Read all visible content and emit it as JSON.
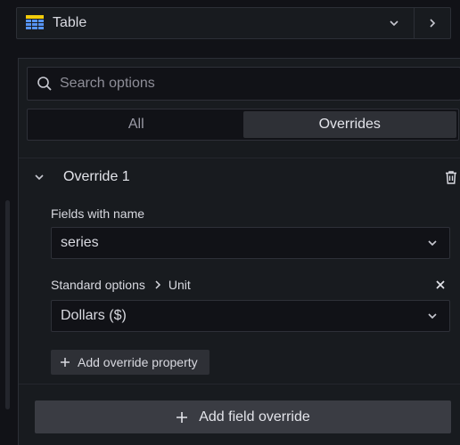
{
  "visualization": {
    "name": "Table",
    "icon": "table-icon"
  },
  "search": {
    "placeholder": "Search options",
    "value": ""
  },
  "tabs": [
    {
      "label": "All",
      "active": false
    },
    {
      "label": "Overrides",
      "active": true
    }
  ],
  "override": {
    "title": "Override 1",
    "matcher_label": "Fields with name",
    "matcher_value": "series",
    "property": {
      "category": "Standard options",
      "name": "Unit",
      "value": "Dollars ($)"
    },
    "add_property_label": "Add override property"
  },
  "add_field_override_label": "Add field override",
  "colors": {
    "background": "#111217",
    "panel": "#181b1f",
    "border": "#2e3038",
    "active_tab": "#2e3036",
    "primary_button": "#3a3c43",
    "text": "#d8d9e0",
    "muted_text": "#8e8e98"
  }
}
